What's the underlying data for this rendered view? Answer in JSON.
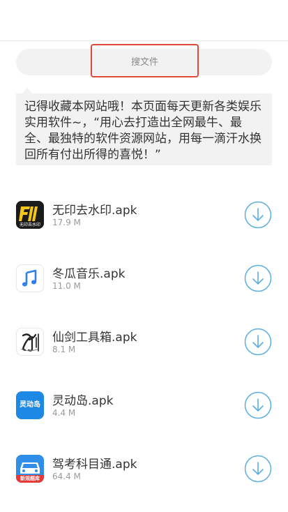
{
  "search": {
    "placeholder": "搜文件"
  },
  "notice": {
    "text": "记得收藏本网站哦！本页面每天更新各类娱乐实用软件~，“用心去打造出全网最牛、最全、最独特的软件资源网站，用每一滴汗水换回所有付出所得的喜悦！”"
  },
  "files": [
    {
      "name": "无印去水印.apk",
      "size": "17.9 M",
      "icon": "watermark-app-icon",
      "icon_text": "无印去水印"
    },
    {
      "name": "冬瓜音乐.apk",
      "size": "11.0 M",
      "icon": "music-note-icon"
    },
    {
      "name": "仙剑工具箱.apk",
      "size": "8.1 M",
      "icon": "sword-calligraphy-icon"
    },
    {
      "name": "灵动岛.apk",
      "size": "4.4 M",
      "icon": "dynamic-island-icon",
      "icon_text": "灵动岛"
    },
    {
      "name": "驾考科目通.apk",
      "size": "64.4 M",
      "icon": "driving-test-icon",
      "icon_text": "新规题库"
    }
  ],
  "colors": {
    "accent": "#5aaee0",
    "highlight_border": "#e04a3a",
    "panel": "#f2f2f2"
  }
}
